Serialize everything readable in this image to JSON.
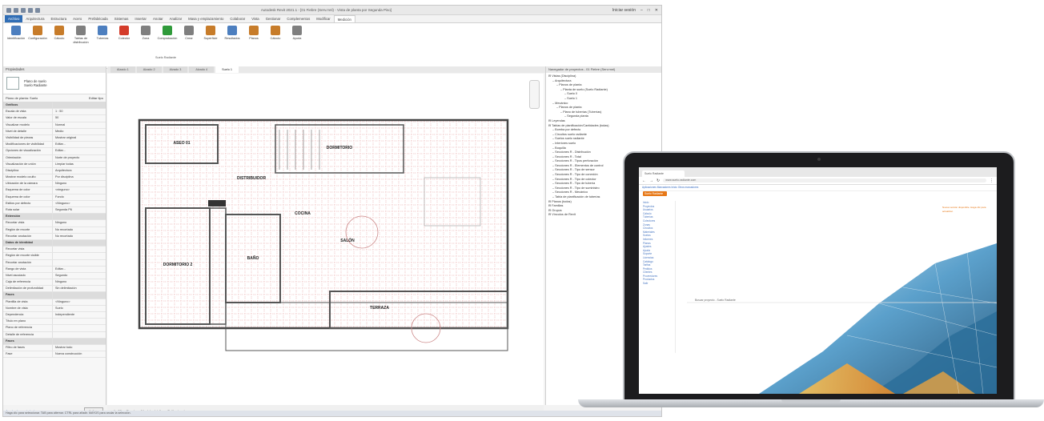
{
  "revit": {
    "title": "Autodesk Revit 2021.1 - [01 Fiebre (Serv.mnl) - Vista de planta por Segunda Piso]",
    "qat_label": "Iniciar sesión",
    "tabs": [
      "Archivo",
      "Arquitectura",
      "Estructura",
      "Acero",
      "Prefabricada",
      "Sistemas",
      "Insertar",
      "Anotar",
      "Analizar",
      "Masa y emplazamiento",
      "Colaborar",
      "Vista",
      "Gestionar",
      "Complementos",
      "Modificar",
      "Medición"
    ],
    "ribbon_buttons": [
      {
        "label": "Identificación",
        "color": "#4d7fbf"
      },
      {
        "label": "Configuración",
        "color": "#c77c2a"
      },
      {
        "label": "Cálculo",
        "color": "#c77c2a"
      },
      {
        "label": "Tablas de distribución",
        "color": "#7f7f7f"
      },
      {
        "label": "Tuberías",
        "color": "#4d7fbf"
      },
      {
        "label": "Colector",
        "color": "#d43c2a"
      },
      {
        "label": "Zona",
        "color": "#7f7f7f"
      },
      {
        "label": "Comprobación",
        "color": "#2f9a3a"
      },
      {
        "label": "Crear",
        "color": "#7f7f7f"
      },
      {
        "label": "Superficie",
        "color": "#c77c2a"
      },
      {
        "label": "Resultados",
        "color": "#4d7fbf"
      },
      {
        "label": "Planos",
        "color": "#c77c2a"
      },
      {
        "label": "Cálculo",
        "color": "#c77c2a"
      },
      {
        "label": "Ayuda",
        "color": "#7f7f7f"
      }
    ],
    "panel_label": "Suelo Radiante",
    "properties": {
      "header": "Propiedades",
      "type_name_1": "Plano de suelo",
      "type_name_2": "Suelo Radiante",
      "filter_label": "Plano de planta: Suelo",
      "edit_type": "Editar tipo",
      "rows": [
        {
          "k": "Gráficos",
          "v": "",
          "sec": true
        },
        {
          "k": "Escala de vista",
          "v": "1 : 50"
        },
        {
          "k": "Valor de escala",
          "v": "50"
        },
        {
          "k": "Visualizar modelo",
          "v": "Normal"
        },
        {
          "k": "Nivel de detalle",
          "v": "Medio"
        },
        {
          "k": "Visibilidad de piezas",
          "v": "Mostrar original"
        },
        {
          "k": "Modificaciones de visibilidad",
          "v": "Editar..."
        },
        {
          "k": "Opciones de visualización",
          "v": "Editar..."
        },
        {
          "k": "Orientación",
          "v": "Norte de proyecto"
        },
        {
          "k": "Visualización de unión",
          "v": "Limpiar todas"
        },
        {
          "k": "Disciplina",
          "v": "Arquitectura"
        },
        {
          "k": "Mostrar modelo oculto",
          "v": "Por disciplina"
        },
        {
          "k": "Ubicación de la cámara",
          "v": "Ninguno"
        },
        {
          "k": "Esquema de color",
          "v": "<ninguno>"
        },
        {
          "k": "Esquema de color",
          "v": "Fondo"
        },
        {
          "k": "Estilos por defecto",
          "v": "<Ninguno>"
        },
        {
          "k": "Ruta solar",
          "v": "Segunda P6"
        },
        {
          "k": "Extensión",
          "v": "",
          "sec": true
        },
        {
          "k": "Recortar vista",
          "v": "Ninguno"
        },
        {
          "k": "Región de recorte",
          "v": "No recortado"
        },
        {
          "k": "Recortar anotación",
          "v": "No recortado"
        },
        {
          "k": "Datos de identidad",
          "v": "",
          "sec": true
        },
        {
          "k": "Recortar vista",
          "v": ""
        },
        {
          "k": "Región de recorte visible",
          "v": ""
        },
        {
          "k": "Recortar anotación",
          "v": ""
        },
        {
          "k": "Rango de vista",
          "v": "Editar..."
        },
        {
          "k": "Nivel asociado",
          "v": "Segundo"
        },
        {
          "k": "Caja de referencia",
          "v": "Ninguno"
        },
        {
          "k": "Delimitación de profundidad",
          "v": "Sin delimitación"
        },
        {
          "k": "Fases",
          "v": "",
          "sec": true
        },
        {
          "k": "Plantilla de vista",
          "v": "<Ninguno>"
        },
        {
          "k": "Nombre de vista",
          "v": "Suelo"
        },
        {
          "k": "Dependencia",
          "v": "Independiente"
        },
        {
          "k": "Título en plano",
          "v": ""
        },
        {
          "k": "Plano de referencia",
          "v": ""
        },
        {
          "k": "Detalle de referencia",
          "v": ""
        },
        {
          "k": "Fases",
          "v": "",
          "sec": true
        },
        {
          "k": "Filtro de fases",
          "v": "Mostrar todo"
        },
        {
          "k": "Fase",
          "v": "Nueva construcción"
        }
      ],
      "help_link": "Ayuda de propiedades",
      "apply": "Aplicar"
    },
    "view_tabs": [
      "Alzado 1",
      "Alzado 2",
      "Alzado 3",
      "Alzado 4",
      "Suelo 1"
    ],
    "active_view_index": 4,
    "view_control": [
      "1 : 50",
      "Escala",
      "Nivel de detalle",
      "Estilo visual"
    ],
    "room_labels": [
      "ASEO 01",
      "DISTRIBUIDOR",
      "DORMITORIO",
      "SALÓN",
      "DORMITORIO 2",
      "BAÑO",
      "COCINA",
      "TERRAZA"
    ],
    "project_browser": {
      "header": "Navegador de proyectos - 01 Fiebre (Serv.mnl)",
      "nodes": [
        {
          "t": "Vistas (Disciplina)",
          "d": 0
        },
        {
          "t": "Arquitectura",
          "d": 1
        },
        {
          "t": "Planos de planta",
          "d": 2
        },
        {
          "t": "Planta de suelo (Suelo Radiante)",
          "d": 3
        },
        {
          "t": "Suelo 0",
          "d": 4
        },
        {
          "t": "Suelo 1",
          "d": 4
        },
        {
          "t": "Mecánico",
          "d": 1
        },
        {
          "t": "Planos de planta",
          "d": 2
        },
        {
          "t": "Plano de tuberías (Tuberías)",
          "d": 3
        },
        {
          "t": "Segunda planta",
          "d": 4
        },
        {
          "t": "Leyendas",
          "d": 0
        },
        {
          "t": "Tablas de planificación/Cantidades (todas)",
          "d": 0
        },
        {
          "t": "Bomba por defecto",
          "d": 1
        },
        {
          "t": "Circuitos suelo radiante",
          "d": 1
        },
        {
          "t": "Suelos suelo radiante",
          "d": 1
        },
        {
          "t": "Interiores suelo",
          "d": 1
        },
        {
          "t": "Boquilla",
          "d": 1
        },
        {
          "t": "Secciones R - Distribución",
          "d": 1
        },
        {
          "t": "Secciones R - Total",
          "d": 1
        },
        {
          "t": "Secciones R - Tipos perforación",
          "d": 1
        },
        {
          "t": "Secciones R - Elementos de control",
          "d": 1
        },
        {
          "t": "Secciones R - Tipo de sensor",
          "d": 1
        },
        {
          "t": "Secciones R - Tipo de conexión",
          "d": 1
        },
        {
          "t": "Secciones R - Tipo de colector",
          "d": 1
        },
        {
          "t": "Secciones R - Tipo de tubería",
          "d": 1
        },
        {
          "t": "Secciones R - Tipo de suministro",
          "d": 1
        },
        {
          "t": "Secciones R - Mecánico",
          "d": 1
        },
        {
          "t": "Tabla de planificación de tuberías",
          "d": 1
        },
        {
          "t": "Planos (todos)",
          "d": 0
        },
        {
          "t": "Familias",
          "d": 0
        },
        {
          "t": "Grupos",
          "d": 0
        },
        {
          "t": "Vínculos de Revit",
          "d": 0
        }
      ]
    },
    "status": "Haga clic para seleccionar. TAB para alternar. CTRL para añadir. MAYÚS para anular la selección."
  },
  "laptop": {
    "browser_tab": "Suelo Radiante",
    "url": "www.suelo-radiante.com",
    "bookmarks": "Aplicaciones  Marcadores  Inicio  Otros marcadores",
    "app_logo": "Suelo Radiante",
    "sidebar_items": [
      "Inicio",
      "Proyectos",
      "Usuarios",
      "Cálculo",
      "Tuberías",
      "Colectores",
      "Zonas",
      "Circuitos",
      "Materiales",
      "Suelos",
      "Informes",
      "Planos",
      "Ajustes",
      "Ayuda",
      "Soporte",
      "Licencias",
      "Catálogo",
      "Tarifas",
      "Pedidos",
      "Clientes",
      "Proveedores",
      "Productos",
      "Salir"
    ],
    "search_label": "Buscar proyecto - Suelo Radiante",
    "notice": "Nueva versión disponible. Haga clic para actualizar."
  }
}
